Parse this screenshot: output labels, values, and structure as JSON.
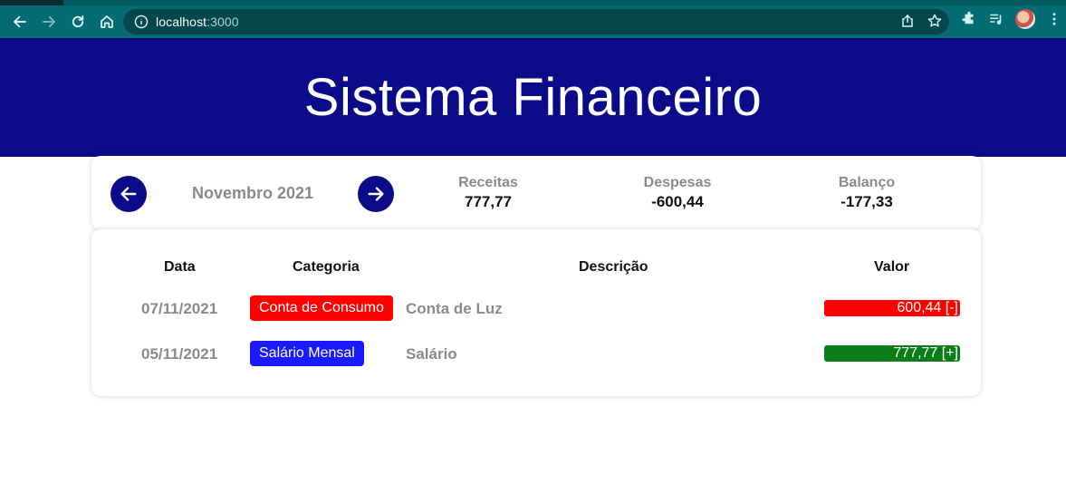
{
  "browser": {
    "url_host": "localhost",
    "url_port": ":3000"
  },
  "app": {
    "title": "Sistema Financeiro"
  },
  "summary": {
    "month": "Novembro 2021",
    "receitas_label": "Receitas",
    "receitas_value": "777,77",
    "despesas_label": "Despesas",
    "despesas_value": "-600,44",
    "balanco_label": "Balanço",
    "balanco_value": "-177,33"
  },
  "table": {
    "headers": {
      "data": "Data",
      "categoria": "Categoria",
      "descricao": "Descrição",
      "valor": "Valor"
    },
    "rows": [
      {
        "date": "07/11/2021",
        "category": "Conta de Consumo",
        "category_color": "#ff0000",
        "description": "Conta de Luz",
        "value": "600,44 [-]",
        "value_color": "#ff0000"
      },
      {
        "date": "05/11/2021",
        "category": "Salário Mensal",
        "category_color": "#1a1aff",
        "description": "Salário",
        "value": "777,77 [+]",
        "value_color": "#0a7d1a"
      }
    ]
  },
  "colors": {
    "header_bg": "#0b0b89",
    "browser_toolbar": "#026c72"
  }
}
